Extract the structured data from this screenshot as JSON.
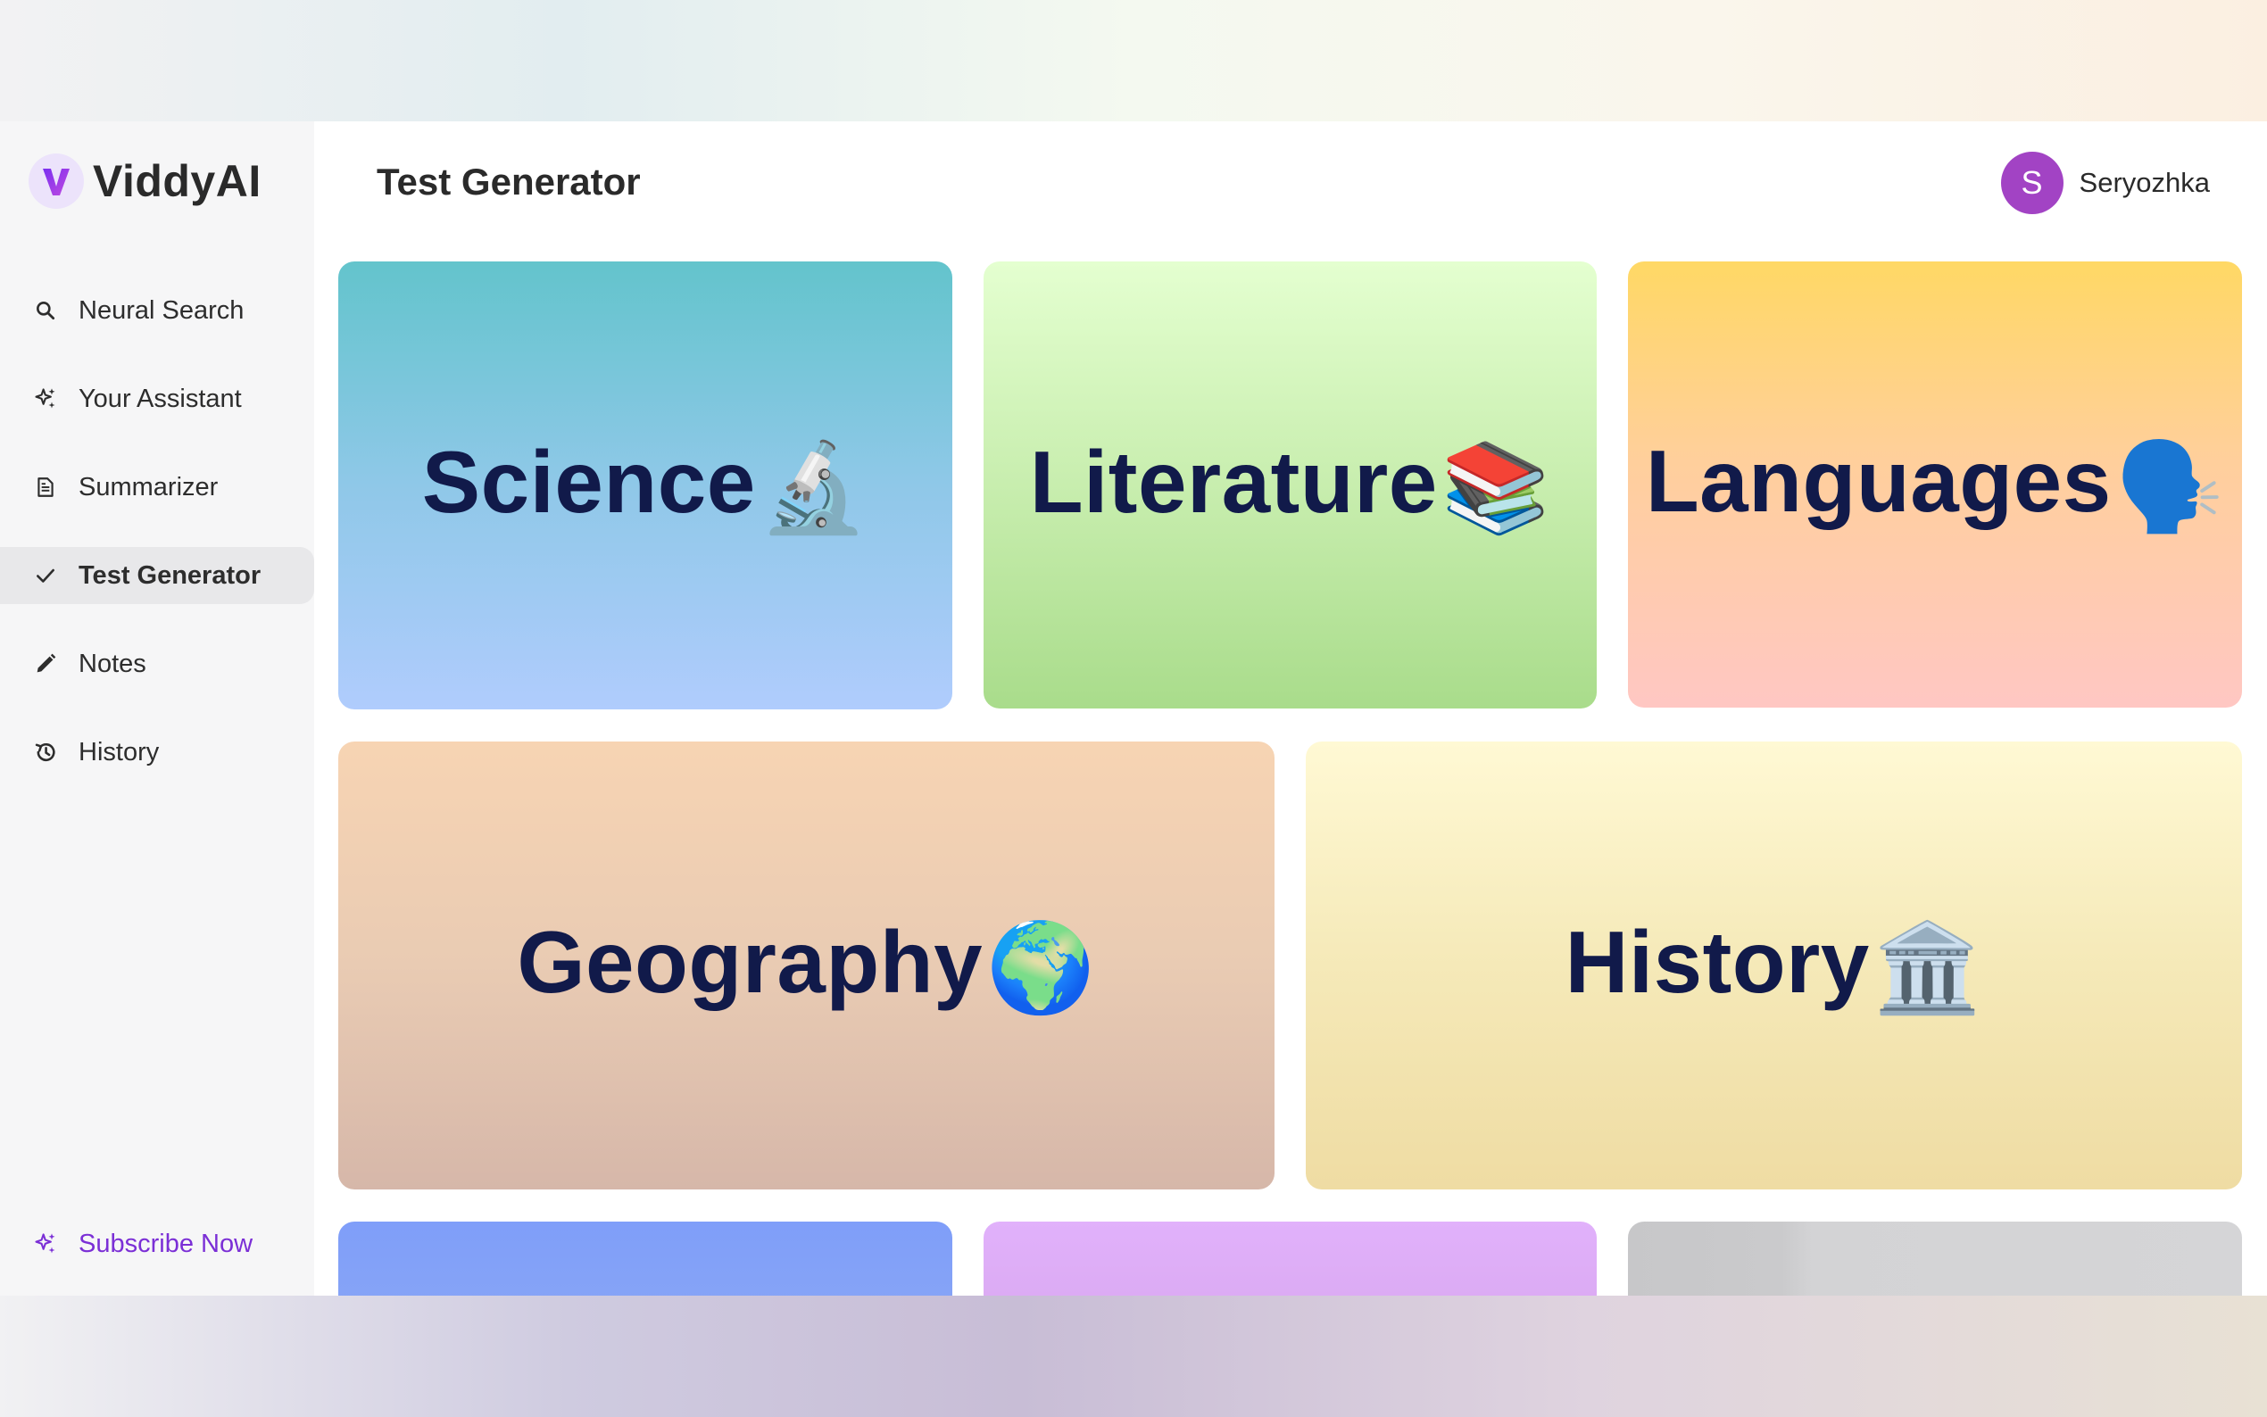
{
  "app": {
    "brand": "ViddyAI",
    "page_title": "Test Generator"
  },
  "sidebar": {
    "items": [
      {
        "label": "Neural Search",
        "icon": "search-icon"
      },
      {
        "label": "Your Assistant",
        "icon": "sparkle-icon"
      },
      {
        "label": "Summarizer",
        "icon": "document-icon"
      },
      {
        "label": "Test Generator",
        "icon": "check-icon",
        "active": true
      },
      {
        "label": "Notes",
        "icon": "pencil-icon"
      },
      {
        "label": "History",
        "icon": "history-icon"
      }
    ],
    "subscribe_label": "Subscribe Now"
  },
  "user": {
    "initial": "S",
    "name": "Seryozhka",
    "avatar_color": "#a243c4"
  },
  "subjects": [
    {
      "label": "Science",
      "emoji": "🔬"
    },
    {
      "label": "Literature",
      "emoji": "📚"
    },
    {
      "label": "Languages",
      "emoji": "🗣️"
    },
    {
      "label": "Geography",
      "emoji": "🌍"
    },
    {
      "label": "History",
      "emoji": "🏛️"
    }
  ],
  "colors": {
    "accent": "#7b2fd6",
    "card_text": "#111a4a"
  }
}
